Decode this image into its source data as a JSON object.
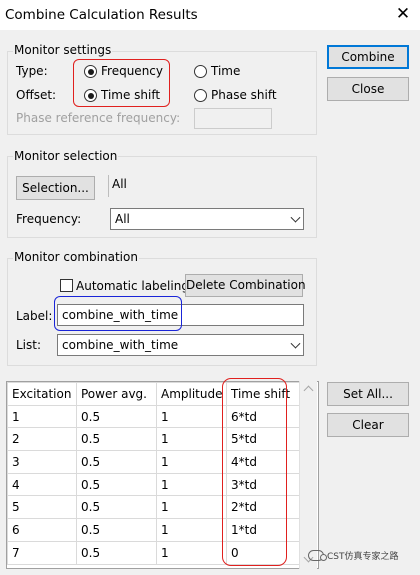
{
  "window": {
    "title": "Combine Calculation Results"
  },
  "monitor_settings": {
    "title": "Monitor settings",
    "type_label": "Type:",
    "offset_label": "Offset:",
    "frequency_label": "Frequency",
    "time_label": "Time",
    "time_shift_label": "Time shift",
    "phase_shift_label": "Phase shift",
    "phase_ref_label": "Phase reference frequency:",
    "phase_ref_value": "",
    "type_selected": "Frequency",
    "offset_selected": "Time shift"
  },
  "monitor_selection": {
    "title": "Monitor selection",
    "selection_button": "Selection...",
    "selection_value": "All",
    "frequency_label": "Frequency:",
    "frequency_value": "All"
  },
  "monitor_combination": {
    "title": "Monitor combination",
    "auto_label_text": "Automatic labeling",
    "auto_label_checked": false,
    "delete_button": "Delete Combination",
    "label_label": "Label:",
    "label_value": "combine_with_time",
    "list_label": "List:",
    "list_value": "combine_with_time"
  },
  "buttons": {
    "combine": "Combine",
    "close": "Close",
    "set_all": "Set All...",
    "clear": "Clear"
  },
  "table": {
    "columns": [
      "Excitation",
      "Power avg.",
      "Amplitude",
      "Time shift"
    ],
    "rows": [
      [
        "1",
        "0.5",
        "1",
        "6*td"
      ],
      [
        "2",
        "0.5",
        "1",
        "5*td"
      ],
      [
        "3",
        "0.5",
        "1",
        "4*td"
      ],
      [
        "4",
        "0.5",
        "1",
        "3*td"
      ],
      [
        "5",
        "0.5",
        "1",
        "2*td"
      ],
      [
        "6",
        "0.5",
        "1",
        "1*td"
      ],
      [
        "7",
        "0.5",
        "1",
        "0"
      ]
    ]
  },
  "watermark": {
    "text": "CST仿真专家之路"
  },
  "colors": {
    "highlight_red": "#e0201e",
    "highlight_blue": "#1a25d8",
    "default_button_border": "#0078d7"
  }
}
